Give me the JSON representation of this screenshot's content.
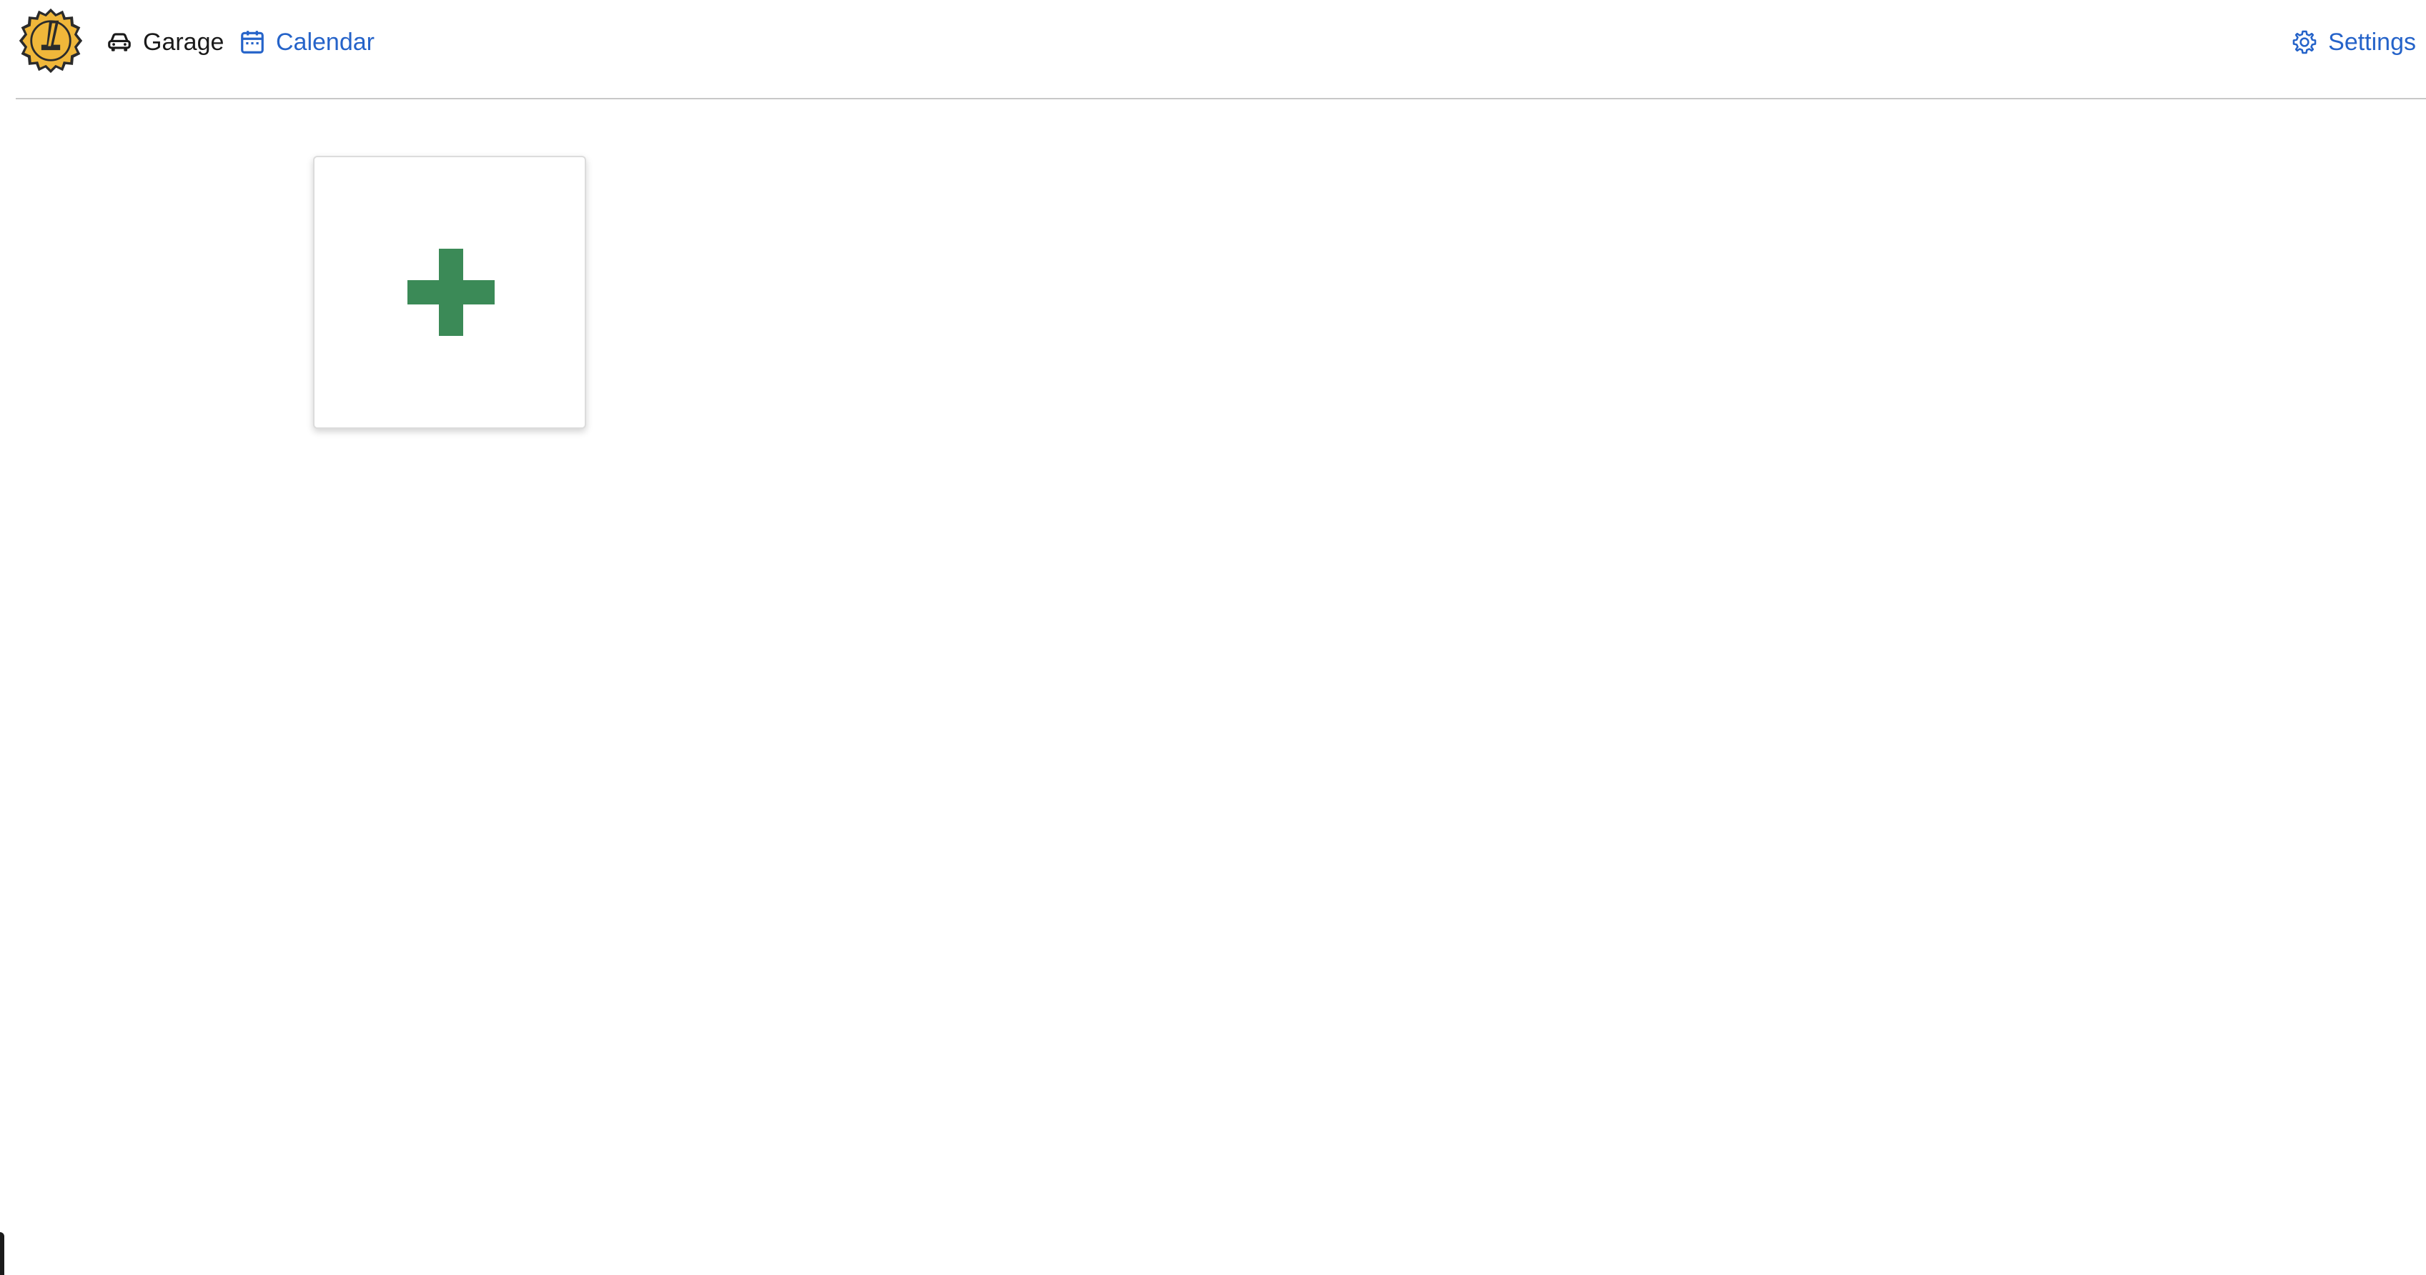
{
  "header": {
    "logo_icon": "gear-wrench-logo-icon",
    "nav": {
      "garage_label": "Garage",
      "garage_icon": "car-icon",
      "calendar_label": "Calendar",
      "calendar_icon": "calendar-icon",
      "settings_label": "Settings",
      "settings_icon": "gear-icon"
    }
  },
  "main": {
    "add_card": {
      "icon": "plus-icon"
    }
  },
  "colors": {
    "link": "#2563c9",
    "plus": "#3b8a57",
    "logo_gold": "#f0b73a",
    "logo_dark": "#2b2b2b",
    "divider": "#c8c8c8"
  }
}
